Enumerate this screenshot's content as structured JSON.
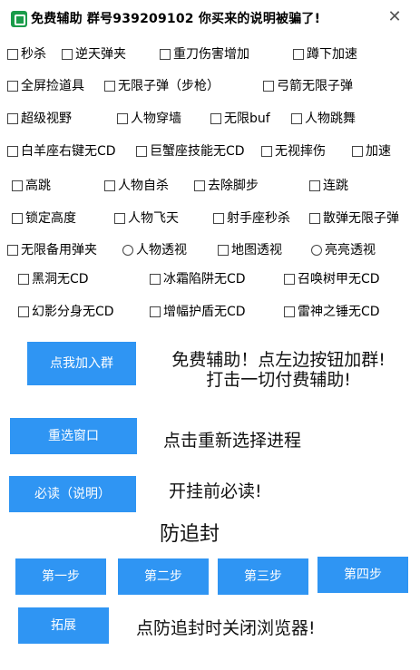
{
  "window": {
    "title": "免费辅助   群号939209102   你买来的说明被骗了!",
    "close_glyph": "✕"
  },
  "options": [
    {
      "label": "秒杀",
      "type": "checkbox",
      "checked": false
    },
    {
      "label": "逆天弹夹",
      "type": "checkbox",
      "checked": false
    },
    {
      "label": "重刀伤害增加",
      "type": "checkbox",
      "checked": false
    },
    {
      "label": "蹲下加速",
      "type": "checkbox",
      "checked": false
    },
    {
      "label": "全屏捡道具",
      "type": "checkbox",
      "checked": false
    },
    {
      "label": "无限子弹（步枪）",
      "type": "checkbox",
      "checked": false
    },
    {
      "label": "弓箭无限子弹",
      "type": "checkbox",
      "checked": false
    },
    {
      "label": "超级视野",
      "type": "checkbox",
      "checked": false
    },
    {
      "label": "人物穿墙",
      "type": "checkbox",
      "checked": false
    },
    {
      "label": "无限buf",
      "type": "checkbox",
      "checked": false
    },
    {
      "label": "人物跳舞",
      "type": "checkbox",
      "checked": false
    },
    {
      "label": "白羊座右键无CD",
      "type": "checkbox",
      "checked": false
    },
    {
      "label": "巨蟹座技能无CD",
      "type": "checkbox",
      "checked": false
    },
    {
      "label": "无视摔伤",
      "type": "checkbox",
      "checked": false
    },
    {
      "label": "加速",
      "type": "checkbox",
      "checked": false
    },
    {
      "label": "高跳",
      "type": "checkbox",
      "checked": false
    },
    {
      "label": "人物自杀",
      "type": "checkbox",
      "checked": false
    },
    {
      "label": "去除脚步",
      "type": "checkbox",
      "checked": false
    },
    {
      "label": "连跳",
      "type": "checkbox",
      "checked": false
    },
    {
      "label": "锁定高度",
      "type": "checkbox",
      "checked": false
    },
    {
      "label": "人物飞天",
      "type": "checkbox",
      "checked": false
    },
    {
      "label": "射手座秒杀",
      "type": "checkbox",
      "checked": false
    },
    {
      "label": "散弹无限子弹",
      "type": "checkbox",
      "checked": false
    },
    {
      "label": "无限备用弹夹",
      "type": "checkbox",
      "checked": false
    },
    {
      "label": "人物透视",
      "type": "radio",
      "checked": false
    },
    {
      "label": "地图透视",
      "type": "checkbox",
      "checked": false
    },
    {
      "label": "亮亮透视",
      "type": "radio",
      "checked": false
    },
    {
      "label": "黑洞无CD",
      "type": "checkbox",
      "checked": false
    },
    {
      "label": "冰霜陷阱无CD",
      "type": "checkbox",
      "checked": false
    },
    {
      "label": "召唤树甲无CD",
      "type": "checkbox",
      "checked": false
    },
    {
      "label": "幻影分身无CD",
      "type": "checkbox",
      "checked": false
    },
    {
      "label": "增幅护盾无CD",
      "type": "checkbox",
      "checked": false
    },
    {
      "label": "雷神之锤无CD",
      "type": "checkbox",
      "checked": false
    }
  ],
  "buttons": {
    "join_group": "点我加入群",
    "reselect_window": "重选窗口",
    "must_read": "必读（说明）",
    "step1": "第一步",
    "step2": "第二步",
    "step3": "第三步",
    "step4": "第四步",
    "extend": "拓展"
  },
  "texts": {
    "join_group_line1": "免费辅助！点左边按钮加群!",
    "join_group_line2": "打击一切付费辅助!",
    "reselect_hint": "点击重新选择进程",
    "must_read_hint": "开挂前必读!",
    "anti_ban_title": "防追封",
    "extend_hint": "点防追封时关闭浏览器!"
  },
  "colors": {
    "button_bg": "#2f95f3",
    "button_text": "#ffffff",
    "app_icon": "#1a9c4a"
  }
}
